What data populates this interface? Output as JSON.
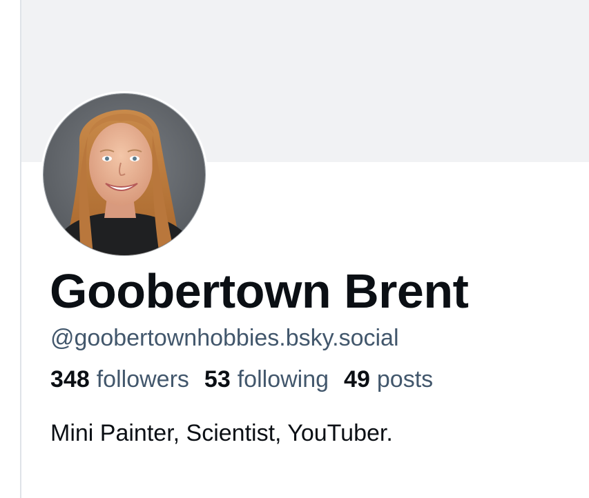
{
  "profile": {
    "display_name": "Goobertown Brent",
    "handle": "@goobertownhobbies.bsky.social",
    "bio": "Mini Painter, Scientist, YouTuber.",
    "stats": {
      "followers_count": "348",
      "followers_label": "followers",
      "following_count": "53",
      "following_label": "following",
      "posts_count": "49",
      "posts_label": "posts"
    }
  },
  "colors": {
    "banner": "#f1f2f4",
    "name_text": "#0b0f14",
    "secondary_text": "#42576c"
  }
}
